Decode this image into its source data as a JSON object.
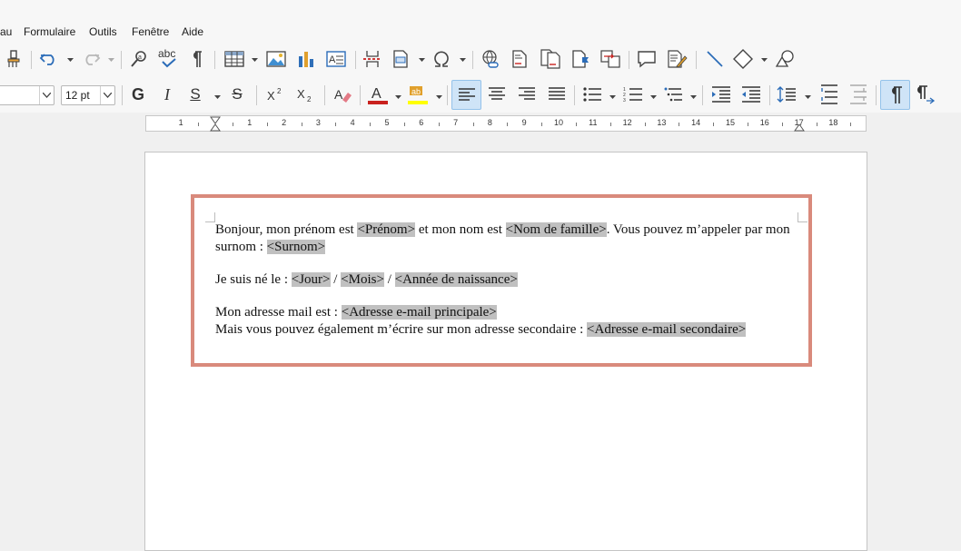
{
  "menu": {
    "items": [
      "au",
      "Formulaire",
      "Outils",
      "Fenêtre",
      "Aide"
    ]
  },
  "toolbar2": {
    "font_size": "12 pt",
    "bold_label": "G",
    "italic_label": "I",
    "underline_label": "S",
    "strike_label": "S"
  },
  "ruler": {
    "numbers": [
      "1",
      "1",
      "2",
      "3",
      "4",
      "5",
      "6",
      "7",
      "8",
      "9",
      "10",
      "11",
      "12",
      "13",
      "14",
      "15",
      "16",
      "17",
      "18"
    ]
  },
  "document": {
    "line1_a": "Bonjour, mon prénom est ",
    "field_prenom": "<Prénom>",
    "line1_b": " et mon nom est ",
    "field_nom": "<Nom de famille>",
    "line1_c": ". Vous pouvez m’appeler par mon surnom : ",
    "field_surnom": "<Surnom>",
    "line2_a": "Je suis né le : ",
    "field_jour": "<Jour>",
    "sep1": " / ",
    "field_mois": "<Mois>",
    "sep2": " / ",
    "field_annee": "<Année de naissance>",
    "line3_a": "Mon adresse mail est : ",
    "field_email1": "<Adresse e-mail principale>",
    "line4_a": "Mais vous pouvez également m’écrire sur mon adresse secondaire : ",
    "field_email2": "<Adresse e-mail secondaire>"
  },
  "colors": {
    "highlight_frame": "#d98a7c",
    "field_bg": "#c0c0c0",
    "font_color": "#c9211e",
    "highlight_color": "#ffff00",
    "active_button": "#cfe4f7"
  },
  "icons": [
    "clone-formatting-icon",
    "undo-icon",
    "redo-icon",
    "find-replace-icon",
    "spellcheck-icon",
    "formatting-marks-icon",
    "table-icon",
    "image-icon",
    "chart-icon",
    "textbox-icon",
    "page-break-icon",
    "field-icon",
    "special-char-icon",
    "hyperlink-icon",
    "footnote-icon",
    "endnote-icon",
    "bookmark-icon",
    "cross-reference-icon",
    "comment-icon",
    "track-changes-icon",
    "line-icon",
    "shapes-icon",
    "draw-functions-icon"
  ]
}
